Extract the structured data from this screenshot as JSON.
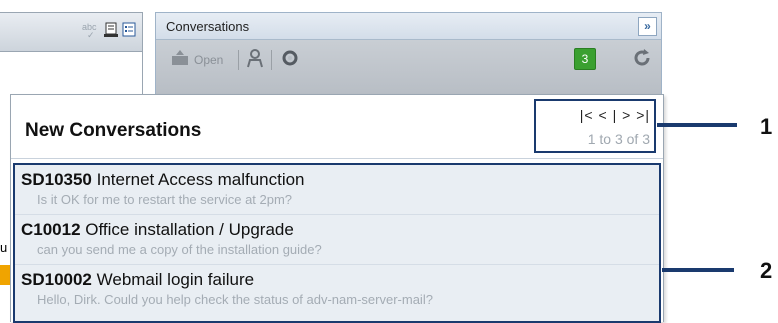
{
  "left_toolbar": {
    "spell_icon": "spellcheck-icon",
    "icons": [
      "document-icon",
      "list-icon"
    ],
    "fragment_text": "u"
  },
  "panel": {
    "title": "Conversations",
    "collapse_label": "»",
    "toolbar": {
      "open_label": "Open",
      "new_count": "3"
    }
  },
  "popup": {
    "title": "New Conversations",
    "pager": {
      "first": "|<",
      "prev": "<",
      "sep": "|",
      "next": ">",
      "last": ">|",
      "range": "1 to 3 of 3"
    },
    "items": [
      {
        "id": "SD10350",
        "subject": "Internet Access malfunction",
        "preview": "Is it OK for me to restart the service at 2pm?"
      },
      {
        "id": "C10012",
        "subject": "Office installation / Upgrade",
        "preview": "can you send me a copy of the installation guide?"
      },
      {
        "id": "SD10002",
        "subject": "Webmail login failure",
        "preview": "Hello, Dirk. Could you help check the status of adv-nam-server-mail?"
      }
    ]
  },
  "callouts": [
    {
      "label": "1"
    },
    {
      "label": "2"
    }
  ],
  "colors": {
    "accent": "#1a3a6e",
    "badge": "#3aa030",
    "highlight": "#f0a400"
  }
}
